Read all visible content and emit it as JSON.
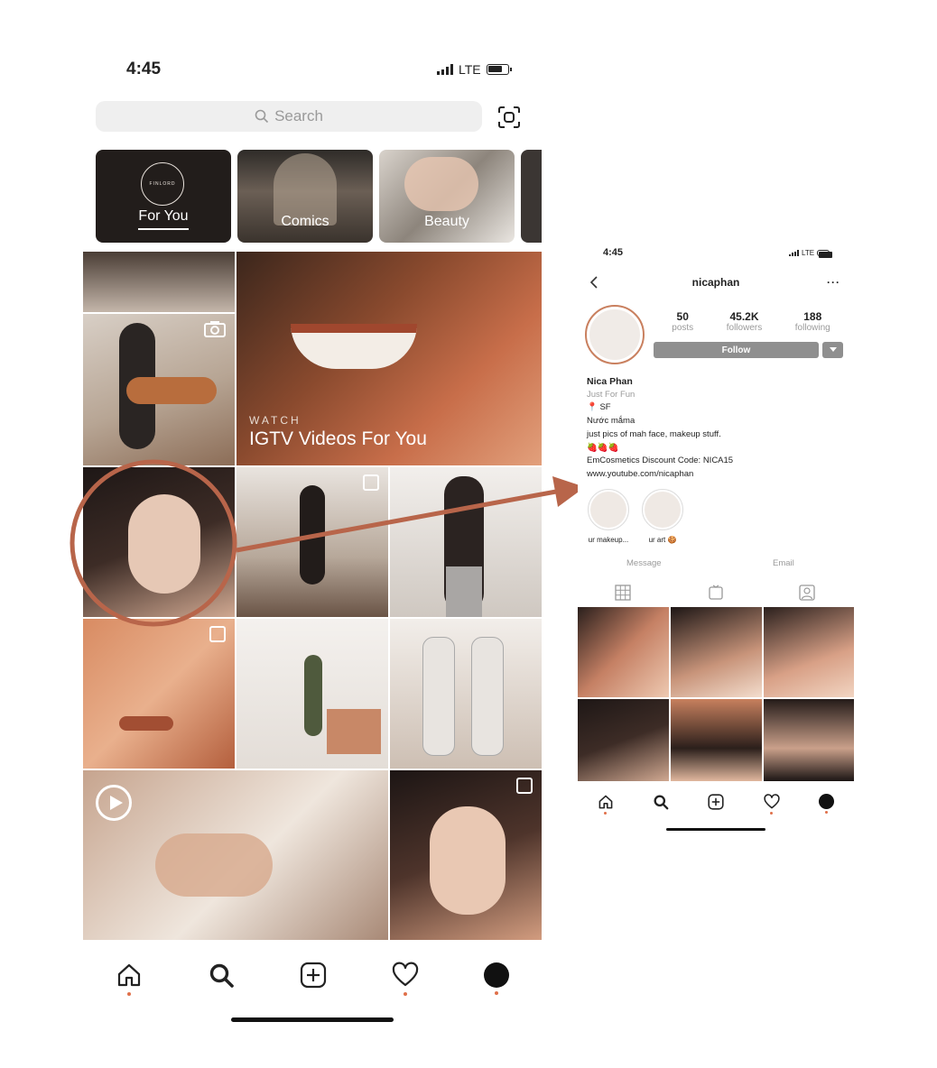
{
  "left": {
    "status": {
      "time": "4:45",
      "network": "LTE"
    },
    "search": {
      "placeholder": "Search"
    },
    "categories": [
      {
        "label": "For You",
        "brand": "FINLORD",
        "active": true
      },
      {
        "label": "Comics"
      },
      {
        "label": "Beauty"
      }
    ],
    "igtv": {
      "kicker": "WATCH",
      "title": "IGTV Videos For You"
    }
  },
  "right": {
    "status": {
      "time": "4:45",
      "network": "LTE"
    },
    "username": "nicaphan",
    "stats": [
      {
        "value": "50",
        "label": "posts"
      },
      {
        "value": "45.2K",
        "label": "followers"
      },
      {
        "value": "188",
        "label": "following"
      }
    ],
    "follow_label": "Follow",
    "bio": {
      "name": "Nica Phan",
      "category": "Just For Fun",
      "location": "📍 SF",
      "line1": "Nước mắma",
      "line2": "just pics of mah face, makeup stuff.",
      "emoji": "🍓🍓🍓",
      "line3": "EmCosmetics Discount Code: NICA15",
      "link": "www.youtube.com/nicaphan"
    },
    "highlights": [
      {
        "label": "ur makeup..."
      },
      {
        "label": "ur art 🍪"
      }
    ],
    "actions": {
      "message": "Message",
      "email": "Email"
    }
  },
  "colors": {
    "accent": "#b8654a",
    "nav_dot": "#e0704a",
    "follow_btn": "#8f8f8f"
  }
}
